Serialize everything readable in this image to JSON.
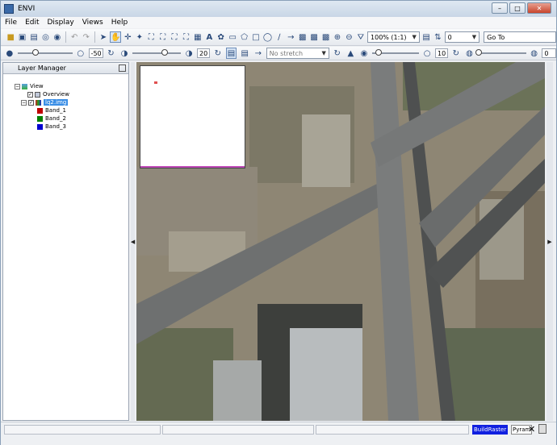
{
  "window": {
    "title": "ENVI",
    "min": "–",
    "max": "□",
    "close": "✕"
  },
  "menu": [
    "File",
    "Edit",
    "Display",
    "Views",
    "Help"
  ],
  "toolbar": {
    "zoom_value": "100% (1:1)",
    "rotate_value": "0",
    "goto_label": "Go To"
  },
  "toolbar2": {
    "brightness_value": "-50",
    "contrast_value": "20",
    "stretch_value": "No stretch",
    "sharpen_value": "10",
    "transparency_value": "0"
  },
  "layer_manager": {
    "title": "Layer Manager",
    "tree": {
      "view": "View",
      "overview": "Overview",
      "raster": "lq2.img",
      "bands": [
        {
          "name": "Band_1",
          "color": "#c00000"
        },
        {
          "name": "Band_2",
          "color": "#008000"
        },
        {
          "name": "Band_3",
          "color": "#0000d0"
        }
      ]
    }
  },
  "status": {
    "process": "BuildRaster",
    "pyramid": "Pyram"
  }
}
